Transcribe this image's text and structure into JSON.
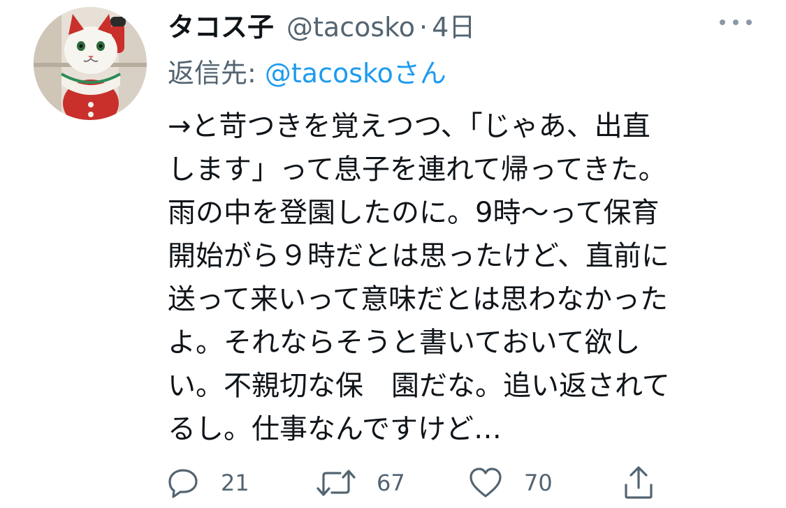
{
  "tweet": {
    "avatar_icon": "maneki-neko-avatar",
    "display_name": "タコス子",
    "handle": "@tacosko",
    "separator": "·",
    "time": "4日",
    "replying_prefix": "返信先: ",
    "replying_to": "@tacoskoさん",
    "body_lines": [
      "→と苛つきを覚えつつ、「じゃあ、出直",
      "します」って息子を連れて帰ってきた。",
      "雨の中を登園したのに。9時〜って保育",
      "開始がら９時だとは思ったけど、直前に",
      "送って来いって意味だとは思わなかった",
      "よ。それならそうと書いておいて欲し",
      "い。不親切な保　園だな。追い返されて",
      "るし。仕事なんですけど…"
    ],
    "more_icon": "more-icon"
  },
  "actions": {
    "reply": {
      "icon": "reply-icon",
      "count": "21"
    },
    "retweet": {
      "icon": "retweet-icon",
      "count": "67"
    },
    "like": {
      "icon": "heart-icon",
      "count": "70"
    },
    "share": {
      "icon": "share-icon"
    }
  },
  "colors": {
    "text": "#0f1419",
    "secondary": "#536471",
    "link": "#1d9bf0",
    "background": "#ffffff"
  }
}
